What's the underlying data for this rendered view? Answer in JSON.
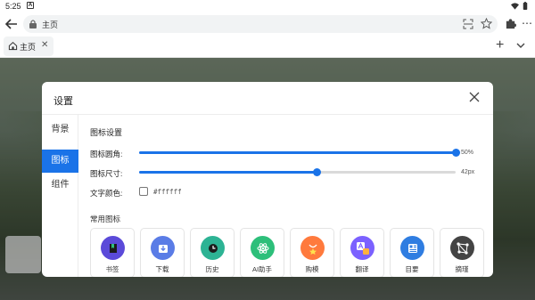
{
  "status_bar": {
    "time": "5:25",
    "notif_glyph": "A"
  },
  "browser": {
    "url_text": "主页",
    "tab_label": "主页",
    "tab_close_glyph": "✕",
    "new_tab_glyph": "+",
    "more_glyph": "⋯"
  },
  "dialog": {
    "title": "设置",
    "nav": [
      {
        "label": "背景",
        "active": false
      },
      {
        "label": "图标",
        "active": true
      },
      {
        "label": "组件",
        "active": false
      }
    ],
    "section_title": "图标设置",
    "radius": {
      "label": "图标圆角:",
      "value_text": "50%",
      "fraction": 1.0
    },
    "size": {
      "label": "图标尺寸:",
      "value_text": "42px",
      "fraction": 0.56
    },
    "text_color": {
      "label": "文字颜色:",
      "value": "#ffffff",
      "checked": false
    },
    "common_title": "常用图标",
    "common_icons": [
      {
        "label": "书签",
        "icon": "bookmark-icon",
        "color": "#5b4ad9"
      },
      {
        "label": "下载",
        "icon": "download-icon",
        "color": "#5a7ce6"
      },
      {
        "label": "历史",
        "icon": "history-icon",
        "color": "#2db394"
      },
      {
        "label": "AI助手",
        "icon": "ai-assistant-icon",
        "color": "#2dbf7a"
      },
      {
        "label": "购模",
        "icon": "shopping-icon",
        "color": "#ff7a3d"
      },
      {
        "label": "翻译",
        "icon": "translate-icon",
        "color": "#7b61ff"
      },
      {
        "label": "目要",
        "icon": "news-icon",
        "color": "#2f7de1"
      },
      {
        "label": "摘瑾",
        "icon": "graph-icon",
        "color": "#444444"
      }
    ]
  },
  "colors": {
    "accent": "#1a73e8"
  }
}
